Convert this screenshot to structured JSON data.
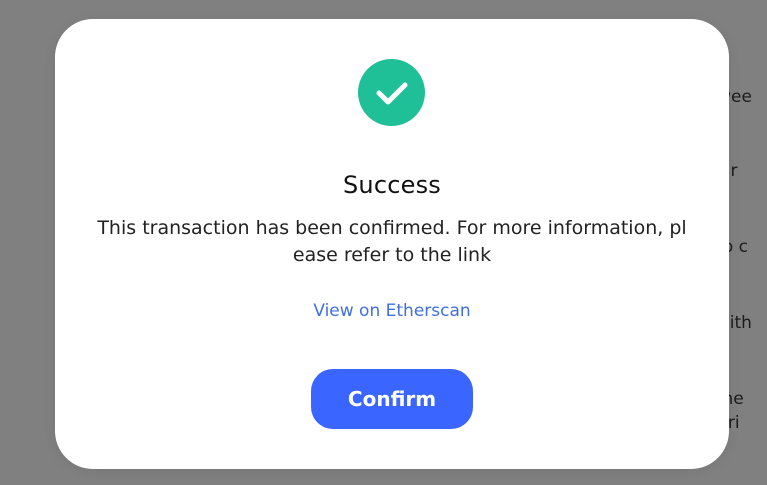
{
  "background": {
    "fragments": [
      "etwee",
      "char",
      "d to c",
      "e with",
      "o the",
      "V pri"
    ]
  },
  "modal": {
    "status_icon": "check-icon",
    "title": "Success",
    "message": "This transaction has been confirmed. For more information, please refer to the link",
    "link_label": "View on Etherscan",
    "confirm_label": "Confirm"
  },
  "colors": {
    "overlay": "#808080",
    "modal_background": "#ffffff",
    "success": "#1fbf97",
    "link": "#3f6fe0",
    "primary_button": "#3b65ff"
  }
}
